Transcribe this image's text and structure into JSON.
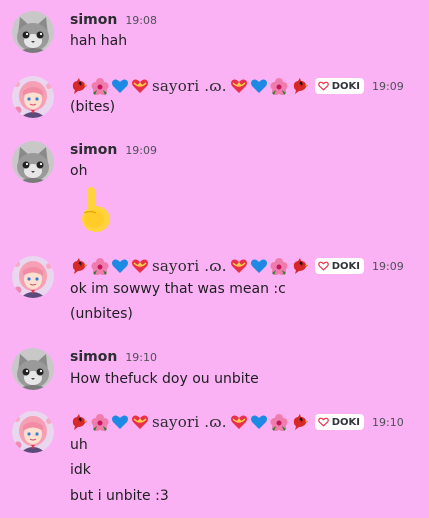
{
  "messages": [
    {
      "author": "simon",
      "time": "19:08",
      "lines": [
        "hah hah"
      ]
    },
    {
      "author": "sayori .ɷ.",
      "time": "19:09",
      "tag": "DOKI",
      "decor_left": [
        "cardinal-bird-icon",
        "hibiscus-icon",
        "blue-heart-icon",
        "heart-with-ribbon-icon"
      ],
      "decor_right": [
        "heart-with-ribbon-icon",
        "blue-heart-icon",
        "hibiscus-icon",
        "cardinal-bird-icon"
      ],
      "lines": [
        "(bites)"
      ]
    },
    {
      "author": "simon",
      "time": "19:09",
      "lines": [
        "oh"
      ],
      "emoji": "middle-finger-emoji"
    },
    {
      "author": "sayori .ɷ.",
      "time": "19:09",
      "tag": "DOKI",
      "lines": [
        "ok im sowwy that was mean :c",
        "(unbites)"
      ]
    },
    {
      "author": "simon",
      "time": "19:10",
      "lines": [
        "How thefuck doy ou unbite"
      ]
    },
    {
      "author": "sayori .ɷ.",
      "time": "19:10",
      "tag": "DOKI",
      "lines": [
        "uh",
        "idk",
        "but i unbite :3"
      ]
    }
  ],
  "colors": {
    "background": "#fbb2f5",
    "tag_background": "#ffffff",
    "heart_red": "#e8304a",
    "heart_blue": "#1e88e5",
    "emoji_yellow": "#ffd33d"
  }
}
